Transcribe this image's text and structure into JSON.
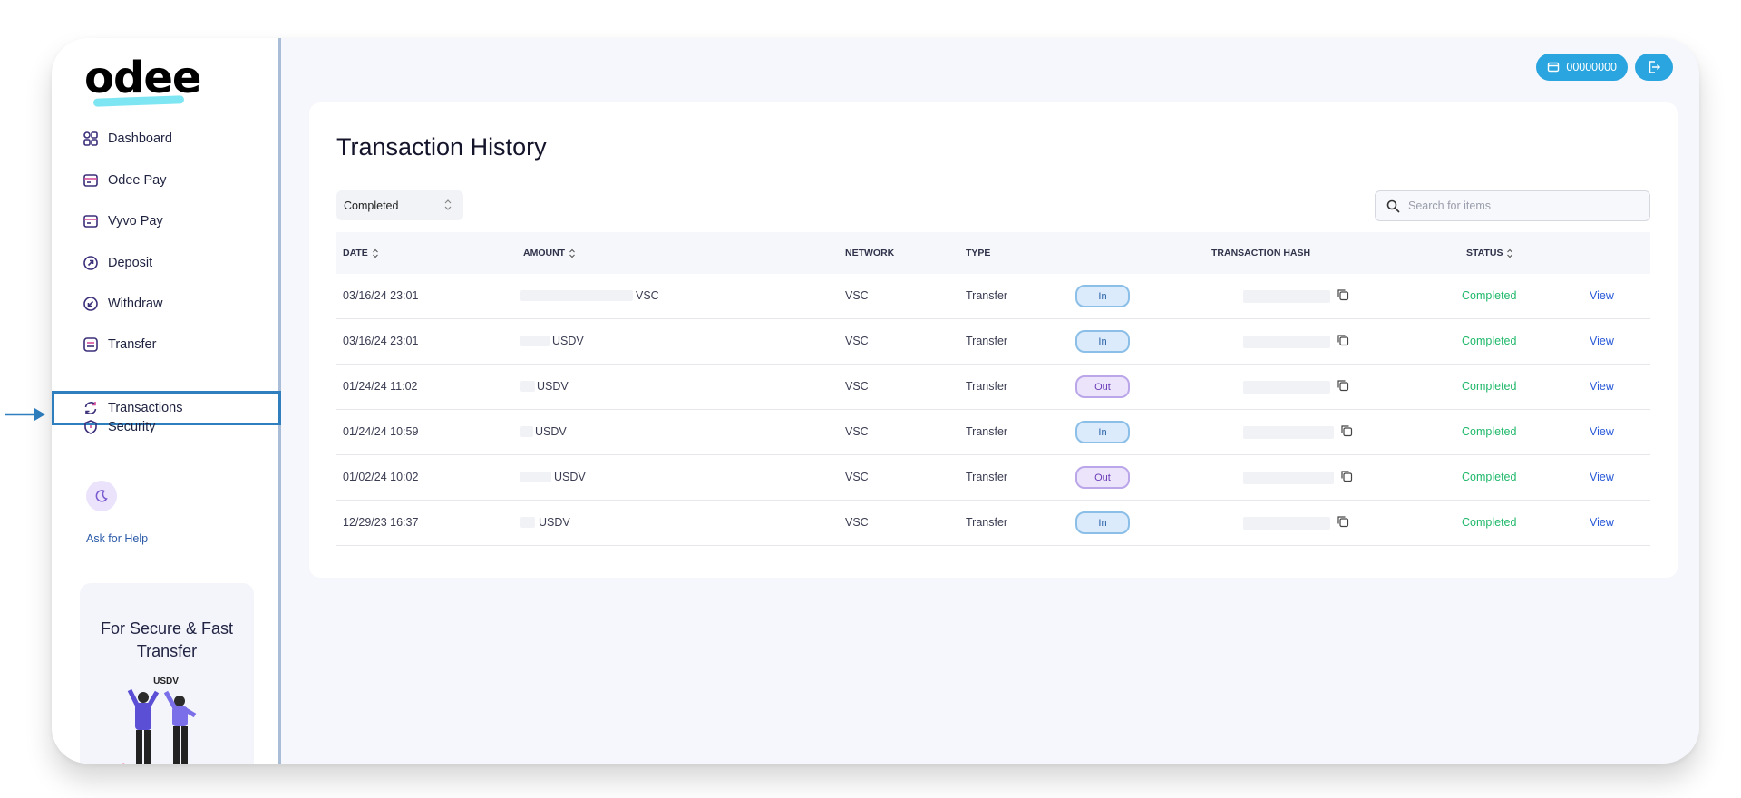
{
  "brand": {
    "name": "odee"
  },
  "sidebar": {
    "items": [
      {
        "label": "Dashboard",
        "icon": "dashboard-icon"
      },
      {
        "label": "Odee Pay",
        "icon": "card-icon"
      },
      {
        "label": "Vyvo Pay",
        "icon": "card-icon"
      },
      {
        "label": "Deposit",
        "icon": "deposit-icon"
      },
      {
        "label": "Withdraw",
        "icon": "withdraw-icon"
      },
      {
        "label": "Transfer",
        "icon": "transfer-icon"
      },
      {
        "label": "Transactions",
        "icon": "refresh-icon",
        "active": true
      },
      {
        "label": "Security",
        "icon": "shield-icon"
      }
    ],
    "help_label": "Ask for Help",
    "promo": {
      "title": "For Secure & Fast Transfer",
      "badge": "USDV"
    }
  },
  "topbar": {
    "account_label": "00000000"
  },
  "main": {
    "title": "Transaction History",
    "filter": {
      "selected": "Completed"
    },
    "search": {
      "placeholder": "Search for items"
    },
    "table": {
      "columns": [
        "DATE",
        "AMOUNT",
        "NETWORK",
        "TYPE",
        "TRANSACTION HASH",
        "STATUS"
      ],
      "rows": [
        {
          "date": "03/16/24 23:01",
          "currency": "VSC",
          "network": "VSC",
          "type": "Transfer",
          "direction": "In",
          "status": "Completed",
          "action": "View"
        },
        {
          "date": "03/16/24 23:01",
          "currency": "USDV",
          "network": "VSC",
          "type": "Transfer",
          "direction": "In",
          "status": "Completed",
          "action": "View"
        },
        {
          "date": "01/24/24 11:02",
          "currency": "USDV",
          "network": "VSC",
          "type": "Transfer",
          "direction": "Out",
          "status": "Completed",
          "action": "View"
        },
        {
          "date": "01/24/24 10:59",
          "currency": "USDV",
          "network": "VSC",
          "type": "Transfer",
          "direction": "In",
          "status": "Completed",
          "action": "View"
        },
        {
          "date": "01/02/24 10:02",
          "currency": "USDV",
          "network": "VSC",
          "type": "Transfer",
          "direction": "Out",
          "status": "Completed",
          "action": "View"
        },
        {
          "date": "12/29/23 16:37",
          "currency": "USDV",
          "network": "VSC",
          "type": "Transfer",
          "direction": "In",
          "status": "Completed",
          "action": "View"
        }
      ]
    }
  },
  "colors": {
    "accent": "#2aa5df",
    "status_completed": "#1fb86a",
    "link": "#2a5ad8",
    "highlight_border": "#2f7fbf"
  }
}
